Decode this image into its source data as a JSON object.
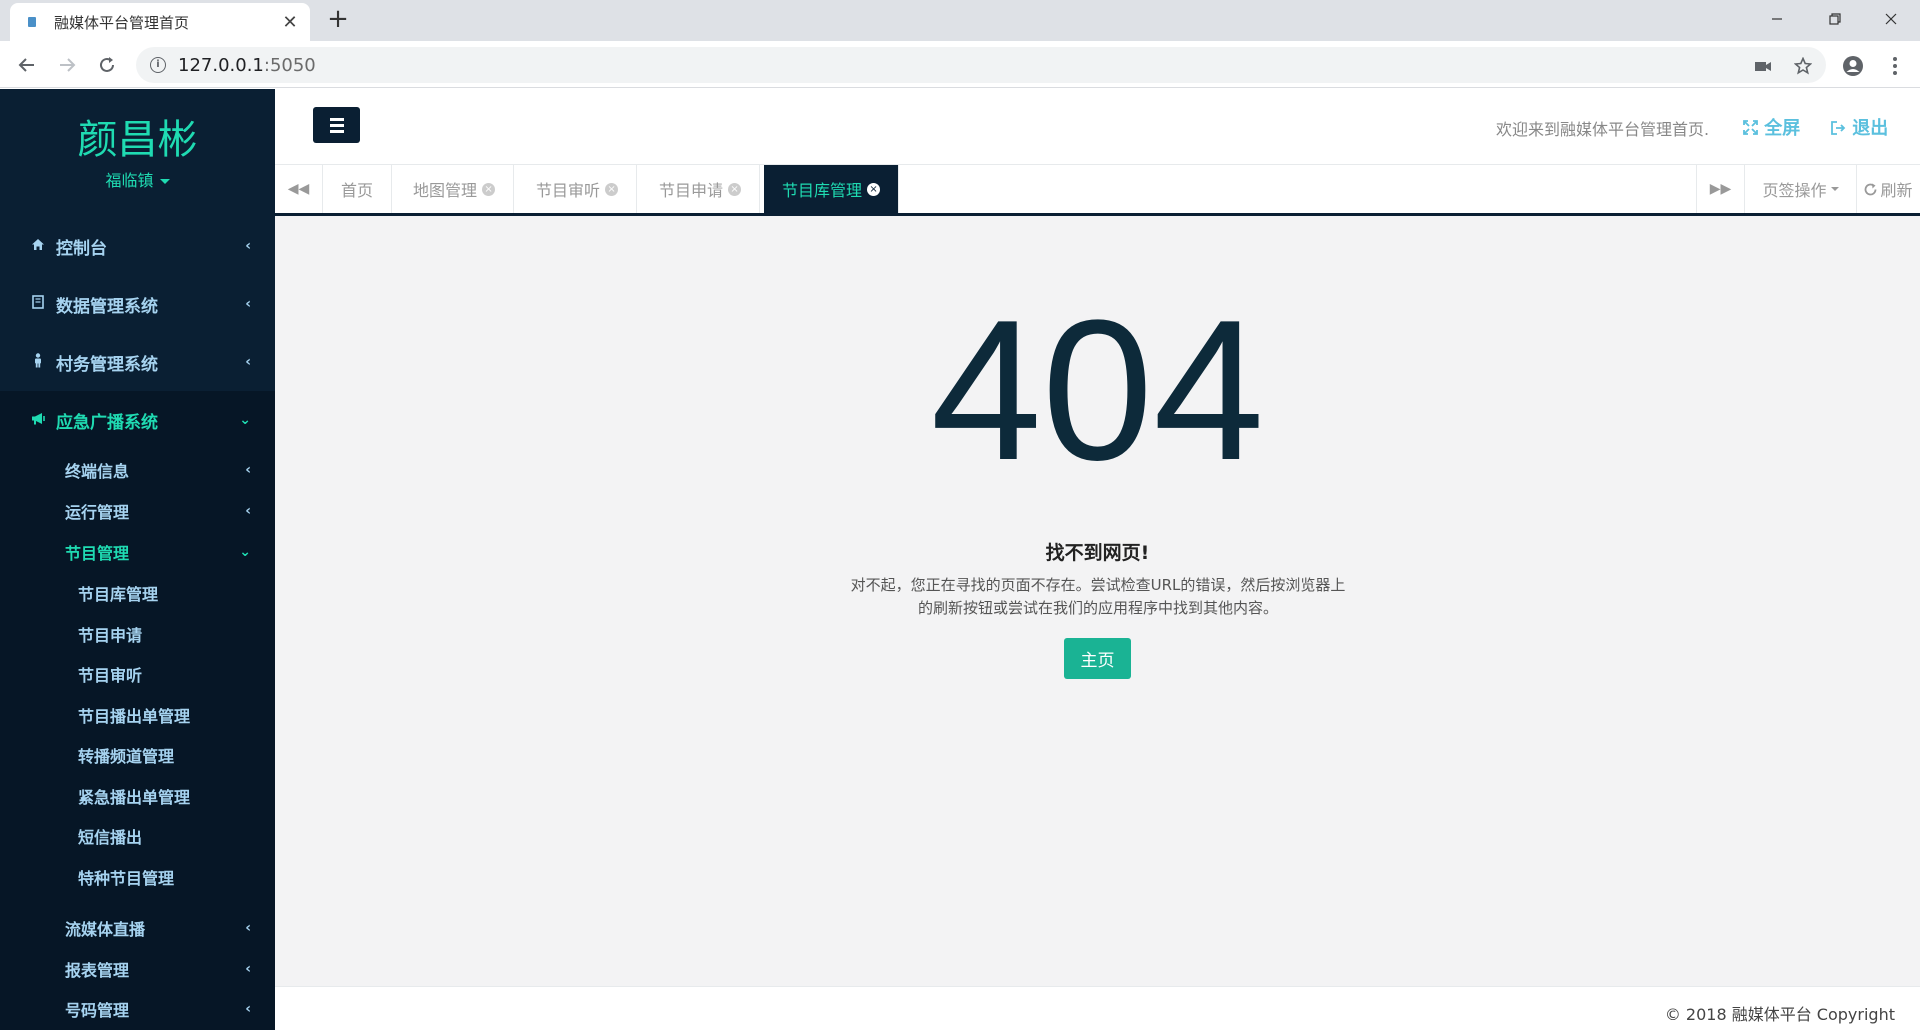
{
  "browser": {
    "tab_title": "融媒体平台管理首页",
    "tab_close": "✕",
    "new_tab": "+",
    "url_host": "127.0.0.1",
    "url_port": ":5050"
  },
  "sidebar": {
    "brand": "颜昌彬",
    "region": "福临镇",
    "items": [
      {
        "label": "控制台",
        "icon": "home-icon"
      },
      {
        "label": "数据管理系统",
        "icon": "book-icon"
      },
      {
        "label": "村务管理系统",
        "icon": "person-icon"
      },
      {
        "label": "应急广播系统",
        "icon": "bullhorn-icon"
      }
    ],
    "sub_items": [
      {
        "label": "终端信息"
      },
      {
        "label": "运行管理"
      },
      {
        "label": "节目管理"
      }
    ],
    "program_items": [
      {
        "label": "节目库管理"
      },
      {
        "label": "节目申请"
      },
      {
        "label": "节目审听"
      },
      {
        "label": "节目播出单管理"
      },
      {
        "label": "转播频道管理"
      },
      {
        "label": "紧急播出单管理"
      },
      {
        "label": "短信播出"
      },
      {
        "label": "特种节目管理"
      }
    ],
    "more_sub_items": [
      {
        "label": "流媒体直播"
      },
      {
        "label": "报表管理"
      },
      {
        "label": "号码管理"
      }
    ]
  },
  "header": {
    "welcome": "欢迎来到融媒体平台管理首页.",
    "fullscreen": "全屏",
    "logout": "退出"
  },
  "content_tabs": {
    "tabs": [
      "首页",
      "地图管理",
      "节目审听",
      "节目申请",
      "节目库管理"
    ],
    "active": "节目库管理",
    "page_ops": "页签操作",
    "refresh": "刷新"
  },
  "error": {
    "code": "404",
    "title": "找不到网页!",
    "description": "对不起，您正在寻找的页面不存在。尝试检查URL的错误，然后按浏览器上的刷新按钮或尝试在我们的应用程序中找到其他内容。",
    "home_button": "主页"
  },
  "footer": {
    "copyright": "© 2018 融媒体平台 Copyright"
  },
  "colors": {
    "sidebar_bg": "#0a1f33",
    "accent": "#1fdbb2",
    "menu_text": "#a6d3f0",
    "primary_button": "#1ab394",
    "link": "#5bc0de"
  }
}
